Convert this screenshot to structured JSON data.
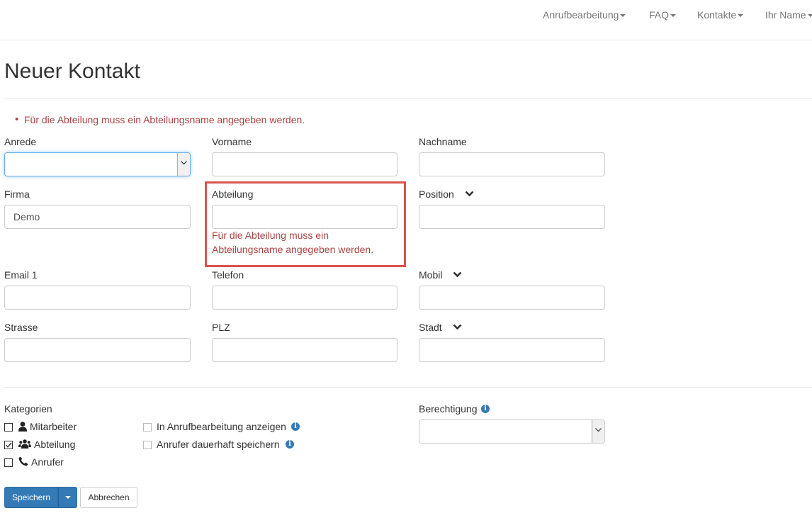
{
  "nav": {
    "items": [
      "Anrufbearbeitung",
      "FAQ",
      "Kontakte",
      "Ihr Name"
    ]
  },
  "page": {
    "title": "Neuer Kontakt",
    "error_summary": "Für die Abteilung muss ein Abteilungsname angegeben werden."
  },
  "form": {
    "anrede": {
      "label": "Anrede",
      "value": ""
    },
    "vorname": {
      "label": "Vorname",
      "value": ""
    },
    "nachname": {
      "label": "Nachname",
      "value": ""
    },
    "firma": {
      "label": "Firma",
      "value": "Demo"
    },
    "abteilung": {
      "label": "Abteilung",
      "value": "",
      "error_line1": "Für die Abteilung muss ein",
      "error_line2": "Abteilungsname angegeben werden."
    },
    "position": {
      "label": "Position",
      "value": ""
    },
    "email1": {
      "label": "Email 1",
      "value": ""
    },
    "telefon": {
      "label": "Telefon",
      "value": ""
    },
    "mobil": {
      "label": "Mobil",
      "value": ""
    },
    "strasse": {
      "label": "Strasse",
      "value": ""
    },
    "plz": {
      "label": "PLZ",
      "value": ""
    },
    "stadt": {
      "label": "Stadt",
      "value": ""
    }
  },
  "kategorien": {
    "label": "Kategorien",
    "items": [
      {
        "label": "Mitarbeiter",
        "checked": false,
        "icon": "user-icon"
      },
      {
        "label": "Abteilung",
        "checked": true,
        "icon": "users-icon"
      },
      {
        "label": "Anrufer",
        "checked": false,
        "icon": "phone-icon"
      }
    ]
  },
  "options": {
    "items": [
      {
        "label": "In Anrufbearbeitung anzeigen",
        "checked": false
      },
      {
        "label": "Anrufer dauerhaft speichern",
        "checked": false
      }
    ]
  },
  "berechtigung": {
    "label": "Berechtigung",
    "value": ""
  },
  "buttons": {
    "save": "Speichern",
    "cancel": "Abbrechen"
  },
  "colors": {
    "primary": "#337ab7",
    "error": "#a94442",
    "error_border": "#d9534f"
  }
}
